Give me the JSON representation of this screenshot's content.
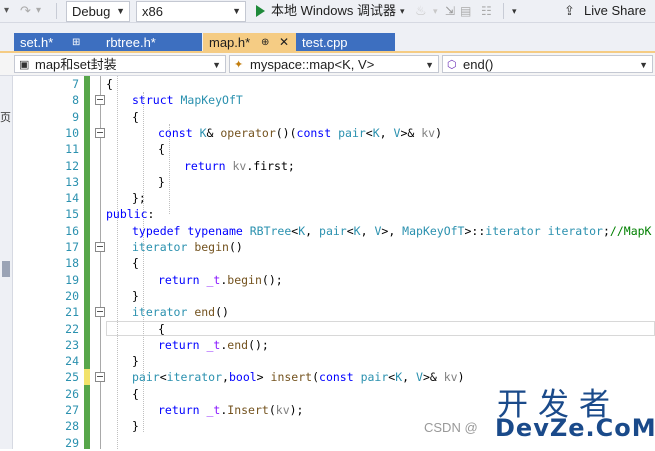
{
  "toolbar": {
    "config": "Debug",
    "platform": "x86",
    "run_label": "本地 Windows 调试器",
    "live_share": "Live Share"
  },
  "tabs": [
    {
      "label": "set.h*",
      "pin": "⊞"
    },
    {
      "label": "rbtree.h*"
    },
    {
      "label": "map.h*",
      "pin": "⊕",
      "close": "✕"
    },
    {
      "label": "test.cpp"
    }
  ],
  "nav": {
    "scope": "map和set封装",
    "class": "myspace::map<K, V>",
    "member": "end()"
  },
  "left_strip": {
    "glyph": "页"
  },
  "editor": {
    "line_numbers": [
      "7",
      "8",
      "9",
      "10",
      "11",
      "12",
      "13",
      "14",
      "15",
      "16",
      "17",
      "18",
      "19",
      "20",
      "21",
      "22",
      "23",
      "24",
      "25",
      "26",
      "27",
      "28",
      "29"
    ],
    "lines": [
      [
        {
          "c": "o",
          "t": "{"
        }
      ],
      [
        {
          "c": "k",
          "t": "struct"
        },
        {
          "c": "o",
          "t": " "
        },
        {
          "c": "t",
          "t": "MapKeyOfT"
        }
      ],
      [
        {
          "c": "o",
          "t": "{"
        }
      ],
      [
        {
          "c": "k",
          "t": "const"
        },
        {
          "c": "o",
          "t": " "
        },
        {
          "c": "t",
          "t": "K"
        },
        {
          "c": "o",
          "t": "& "
        },
        {
          "c": "f",
          "t": "operator"
        },
        {
          "c": "o",
          "t": "()("
        },
        {
          "c": "k",
          "t": "const"
        },
        {
          "c": "o",
          "t": " "
        },
        {
          "c": "t",
          "t": "pair"
        },
        {
          "c": "o",
          "t": "<"
        },
        {
          "c": "t",
          "t": "K"
        },
        {
          "c": "o",
          "t": ", "
        },
        {
          "c": "t",
          "t": "V"
        },
        {
          "c": "o",
          "t": ">& "
        },
        {
          "c": "p",
          "t": "kv"
        },
        {
          "c": "o",
          "t": ")"
        }
      ],
      [
        {
          "c": "o",
          "t": "{"
        }
      ],
      [
        {
          "c": "k",
          "t": "return"
        },
        {
          "c": "o",
          "t": " "
        },
        {
          "c": "p",
          "t": "kv"
        },
        {
          "c": "o",
          "t": "."
        },
        {
          "c": "o",
          "t": "first"
        },
        {
          "c": "o",
          "t": ";"
        }
      ],
      [
        {
          "c": "o",
          "t": "}"
        }
      ],
      [
        {
          "c": "o",
          "t": "};"
        }
      ],
      [
        {
          "c": "k",
          "t": "public"
        },
        {
          "c": "o",
          "t": ":"
        }
      ],
      [
        {
          "c": "k",
          "t": "typedef"
        },
        {
          "c": "o",
          "t": " "
        },
        {
          "c": "k",
          "t": "typename"
        },
        {
          "c": "o",
          "t": " "
        },
        {
          "c": "t",
          "t": "RBTree"
        },
        {
          "c": "o",
          "t": "<"
        },
        {
          "c": "t",
          "t": "K"
        },
        {
          "c": "o",
          "t": ", "
        },
        {
          "c": "t",
          "t": "pair"
        },
        {
          "c": "o",
          "t": "<"
        },
        {
          "c": "t",
          "t": "K"
        },
        {
          "c": "o",
          "t": ", "
        },
        {
          "c": "t",
          "t": "V"
        },
        {
          "c": "o",
          "t": ">, "
        },
        {
          "c": "t",
          "t": "MapKeyOfT"
        },
        {
          "c": "o",
          "t": ">::"
        },
        {
          "c": "t",
          "t": "iterator"
        },
        {
          "c": "o",
          "t": " "
        },
        {
          "c": "t",
          "t": "iterator"
        },
        {
          "c": "o",
          "t": ";"
        },
        {
          "c": "c",
          "t": "//MapK"
        }
      ],
      [
        {
          "c": "t",
          "t": "iterator"
        },
        {
          "c": "o",
          "t": " "
        },
        {
          "c": "f",
          "t": "begin"
        },
        {
          "c": "o",
          "t": "()"
        }
      ],
      [
        {
          "c": "o",
          "t": "{"
        }
      ],
      [
        {
          "c": "k",
          "t": "return"
        },
        {
          "c": "o",
          "t": " "
        },
        {
          "c": "m",
          "t": "_t"
        },
        {
          "c": "o",
          "t": "."
        },
        {
          "c": "f",
          "t": "begin"
        },
        {
          "c": "o",
          "t": "();"
        }
      ],
      [
        {
          "c": "o",
          "t": "}"
        }
      ],
      [
        {
          "c": "t",
          "t": "iterator"
        },
        {
          "c": "o",
          "t": " "
        },
        {
          "c": "f",
          "t": "end"
        },
        {
          "c": "o",
          "t": "()"
        }
      ],
      [
        {
          "c": "o",
          "t": "{"
        }
      ],
      [
        {
          "c": "k",
          "t": "return"
        },
        {
          "c": "o",
          "t": " "
        },
        {
          "c": "m",
          "t": "_t"
        },
        {
          "c": "o",
          "t": "."
        },
        {
          "c": "f",
          "t": "end"
        },
        {
          "c": "o",
          "t": "();"
        }
      ],
      [
        {
          "c": "o",
          "t": "}"
        }
      ],
      [
        {
          "c": "t",
          "t": "pair"
        },
        {
          "c": "o",
          "t": "<"
        },
        {
          "c": "t",
          "t": "iterator"
        },
        {
          "c": "o",
          "t": ","
        },
        {
          "c": "k",
          "t": "bool"
        },
        {
          "c": "o",
          "t": "> "
        },
        {
          "c": "f",
          "t": "insert"
        },
        {
          "c": "o",
          "t": "("
        },
        {
          "c": "k",
          "t": "const"
        },
        {
          "c": "o",
          "t": " "
        },
        {
          "c": "t",
          "t": "pair"
        },
        {
          "c": "o",
          "t": "<"
        },
        {
          "c": "t",
          "t": "K"
        },
        {
          "c": "o",
          "t": ", "
        },
        {
          "c": "t",
          "t": "V"
        },
        {
          "c": "o",
          "t": ">& "
        },
        {
          "c": "p",
          "t": "kv"
        },
        {
          "c": "o",
          "t": ")"
        }
      ],
      [
        {
          "c": "o",
          "t": "{"
        }
      ],
      [
        {
          "c": "k",
          "t": "return"
        },
        {
          "c": "o",
          "t": " "
        },
        {
          "c": "m",
          "t": "_t"
        },
        {
          "c": "o",
          "t": "."
        },
        {
          "c": "f",
          "t": "Insert"
        },
        {
          "c": "o",
          "t": "("
        },
        {
          "c": "p",
          "t": "kv"
        },
        {
          "c": "o",
          "t": ");"
        }
      ],
      [
        {
          "c": "o",
          "t": "}"
        }
      ],
      []
    ]
  },
  "watermark": {
    "chinese": "开发者",
    "english": "DevZe.CoM",
    "csdn": "CSDN @"
  },
  "colors": {
    "keyword": "#0000ff",
    "type": "#2b91af",
    "function": "#74531f",
    "param": "#808080",
    "member": "#8a1bff",
    "comment": "#008000",
    "tab_active": "#f5cc84",
    "tab_inactive": "#3d6fc0",
    "change_saved": "#57a64a",
    "change_unsaved": "#f2e36b"
  }
}
